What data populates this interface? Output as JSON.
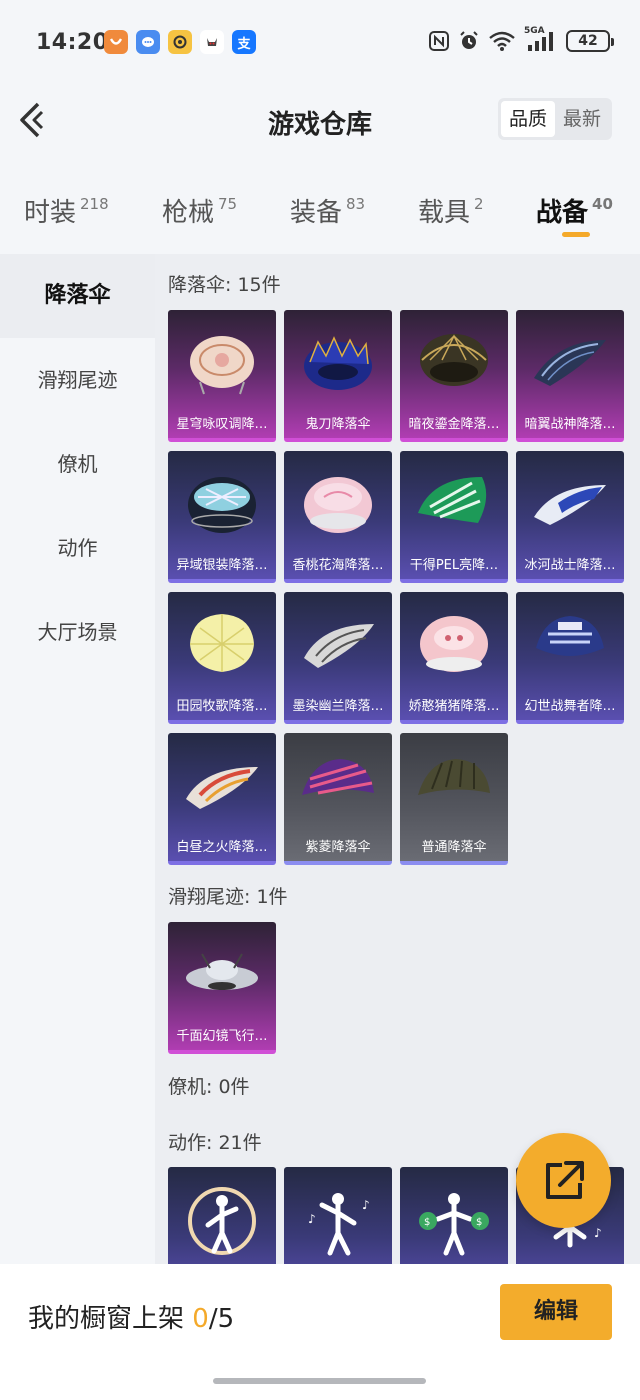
{
  "status_bar": {
    "time": "14:20",
    "app_icons": [
      "app-icon-orange",
      "app-icon-messages",
      "app-icon-ring",
      "app-icon-cat",
      "app-icon-alipay"
    ],
    "alipay_glyph": "支",
    "network": "5GA",
    "battery": "42"
  },
  "header": {
    "title": "游戏仓库",
    "sort_options": [
      "品质",
      "最新"
    ],
    "active_sort": "品质"
  },
  "tabs": [
    {
      "label": "时装",
      "count": "218"
    },
    {
      "label": "枪械",
      "count": "75"
    },
    {
      "label": "装备",
      "count": "83"
    },
    {
      "label": "载具",
      "count": "2"
    },
    {
      "label": "战备",
      "count": "40",
      "active": true
    }
  ],
  "sidebar": {
    "items": [
      "降落伞",
      "滑翔尾迹",
      "僚机",
      "动作",
      "大厅场景"
    ],
    "active": "降落伞"
  },
  "sections": [
    {
      "title": "降落伞: 15件"
    },
    {
      "title": "滑翔尾迹: 1件"
    },
    {
      "title": "僚机: 0件"
    },
    {
      "title": "动作: 21件"
    }
  ],
  "parachutes": [
    {
      "name": "星穹咏叹调降…",
      "rarity": "purple"
    },
    {
      "name": "鬼刀降落伞",
      "rarity": "purple"
    },
    {
      "name": "暗夜鎏金降落…",
      "rarity": "purple"
    },
    {
      "name": "暗翼战神降落…",
      "rarity": "purple"
    },
    {
      "name": "异域银装降落…",
      "rarity": "blue"
    },
    {
      "name": "香桃花海降落…",
      "rarity": "blue"
    },
    {
      "name": "干得PEL亮降…",
      "rarity": "blue"
    },
    {
      "name": "冰河战士降落…",
      "rarity": "blue"
    },
    {
      "name": "田园牧歌降落…",
      "rarity": "blue"
    },
    {
      "name": "墨染幽兰降落…",
      "rarity": "blue"
    },
    {
      "name": "娇憨猪猪降落…",
      "rarity": "blue"
    },
    {
      "name": "幻世战舞者降…",
      "rarity": "blue"
    },
    {
      "name": "白昼之火降落…",
      "rarity": "blue"
    },
    {
      "name": "紫菱降落伞",
      "rarity": "gray"
    },
    {
      "name": "普通降落伞",
      "rarity": "gray"
    }
  ],
  "trails": [
    {
      "name": "千面幻镜飞行…",
      "rarity": "purple"
    }
  ],
  "actions": [
    {
      "name": "",
      "rarity": "blue"
    },
    {
      "name": "",
      "rarity": "blue"
    },
    {
      "name": "",
      "rarity": "blue"
    },
    {
      "name": "",
      "rarity": "blue"
    }
  ],
  "bottom": {
    "shelf_label": "我的橱窗上架",
    "shelf_count": "0",
    "shelf_total": "/5",
    "edit_label": "编辑"
  },
  "colors": {
    "accent": "#f3ac2c",
    "purple_rarity": "#b03db2",
    "blue_rarity": "#5a4fb0",
    "gray_rarity": "#6a6c74"
  }
}
